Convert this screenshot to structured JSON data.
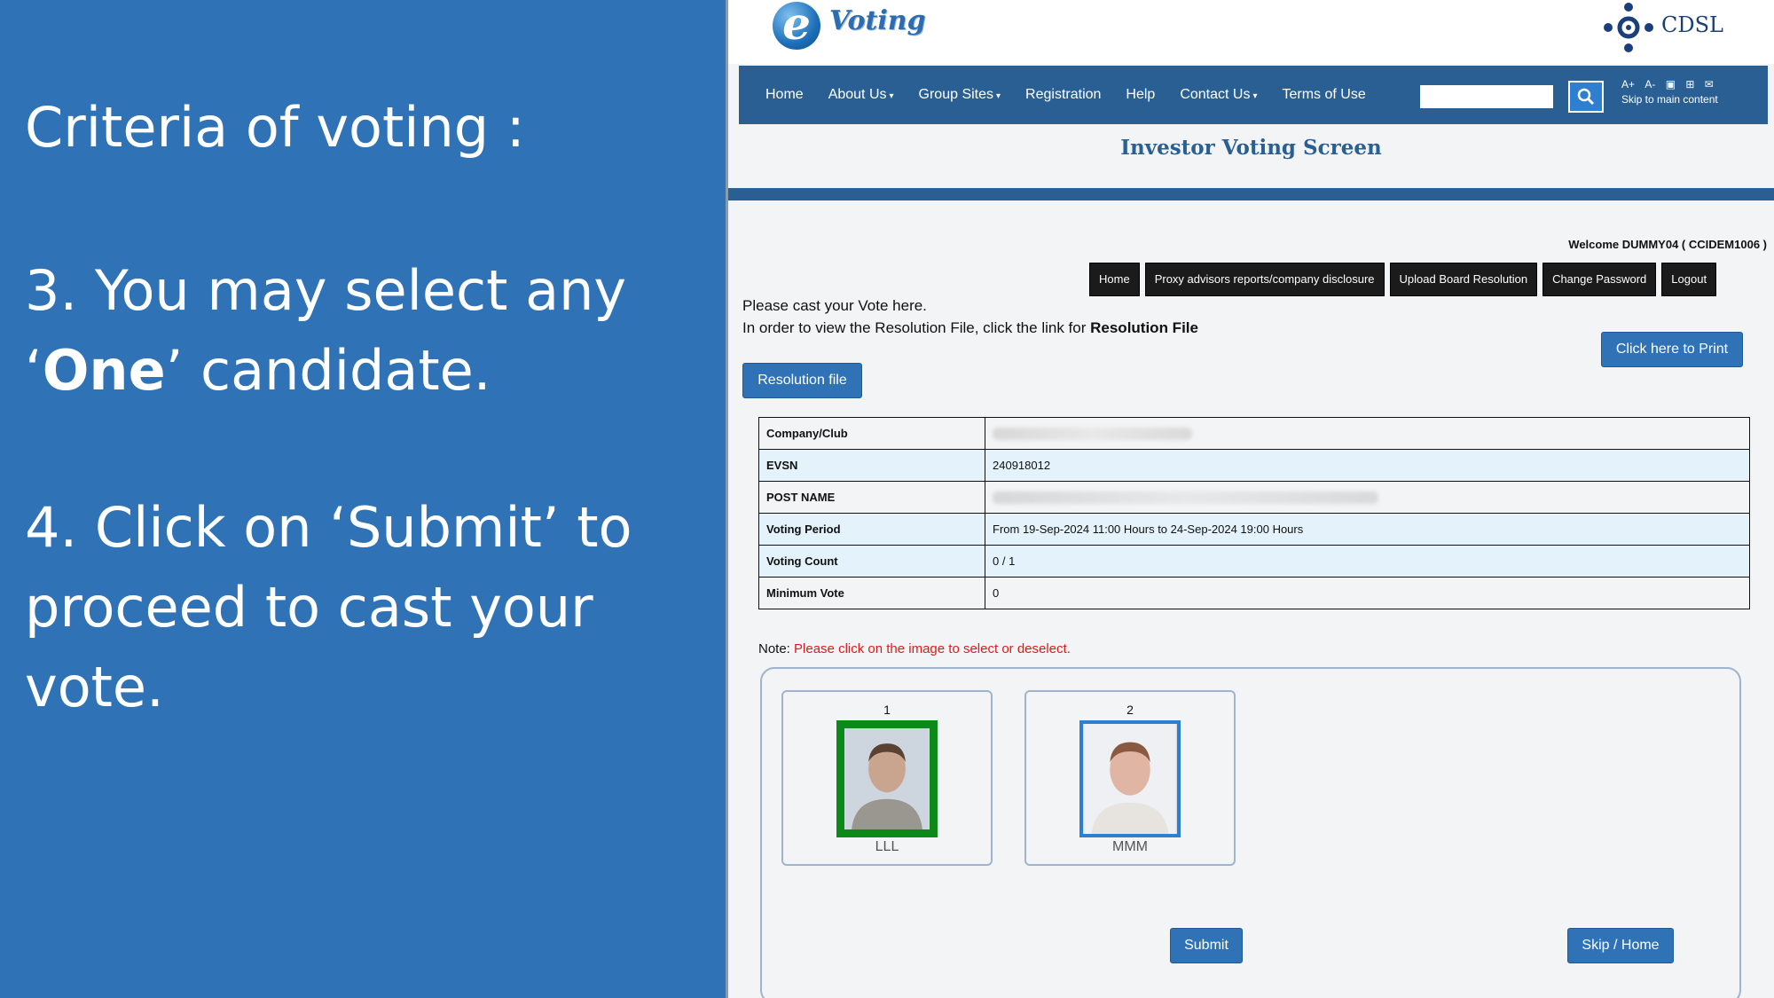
{
  "slide": {
    "criteria_title": "Criteria of voting :",
    "point3_prefix": "3. You may select any ‘",
    "point3_bold": "One",
    "point3_suffix": "’ candidate.",
    "point4_text": "4. Click on ‘Submit’ to proceed to cast your vote."
  },
  "header": {
    "logo_letter": "e",
    "logo_word": "Voting",
    "brand_right": "CDSL"
  },
  "nav": {
    "items": [
      {
        "label": "Home",
        "dropdown": false
      },
      {
        "label": "About Us",
        "dropdown": true
      },
      {
        "label": "Group Sites",
        "dropdown": true
      },
      {
        "label": "Registration",
        "dropdown": false
      },
      {
        "label": "Help",
        "dropdown": false
      },
      {
        "label": "Contact Us",
        "dropdown": true
      },
      {
        "label": "Terms of Use",
        "dropdown": false
      }
    ],
    "search_placeholder": "",
    "font_increase": "A+",
    "font_decrease": "A-",
    "skip_link": "Skip to main content"
  },
  "page": {
    "title": "Investor Voting Screen",
    "welcome": "Welcome DUMMY04 ( CCIDEM1006 )",
    "menu_buttons": [
      "Home",
      "Proxy advisors reports/company disclosure",
      "Upload Board Resolution",
      "Change Password",
      "Logout"
    ],
    "cast_line1": "Please cast your Vote here.",
    "cast_line2_prefix": "In order to view the Resolution File, click the link for ",
    "cast_line2_bold": "Resolution File",
    "print_button": "Click here to Print",
    "resolution_button": "Resolution file"
  },
  "info_table": {
    "rows": [
      {
        "label": "Company/Club",
        "value": ""
      },
      {
        "label": "EVSN",
        "value": "240918012"
      },
      {
        "label": "POST NAME",
        "value": ""
      },
      {
        "label": "Voting Period",
        "value": "From 19-Sep-2024 11:00 Hours to 24-Sep-2024 19:00 Hours"
      },
      {
        "label": "Voting Count",
        "value": "0 / 1"
      },
      {
        "label": "Minimum Vote",
        "value": "0"
      }
    ]
  },
  "note": {
    "prefix": "Note: ",
    "text": "Please click on the image to select or deselect."
  },
  "candidates": [
    {
      "number": "1",
      "name": "LLL",
      "selected": true
    },
    {
      "number": "2",
      "name": "MMM",
      "selected": false
    }
  ],
  "actions": {
    "submit": "Submit",
    "skip_home": "Skip / Home"
  },
  "colors": {
    "slide_bg": "#2f73b6",
    "nav_bg": "#2a5f93",
    "selected_border": "#0b8a1a",
    "unselected_border": "#2f7fd0",
    "note_red": "#e0191b"
  }
}
